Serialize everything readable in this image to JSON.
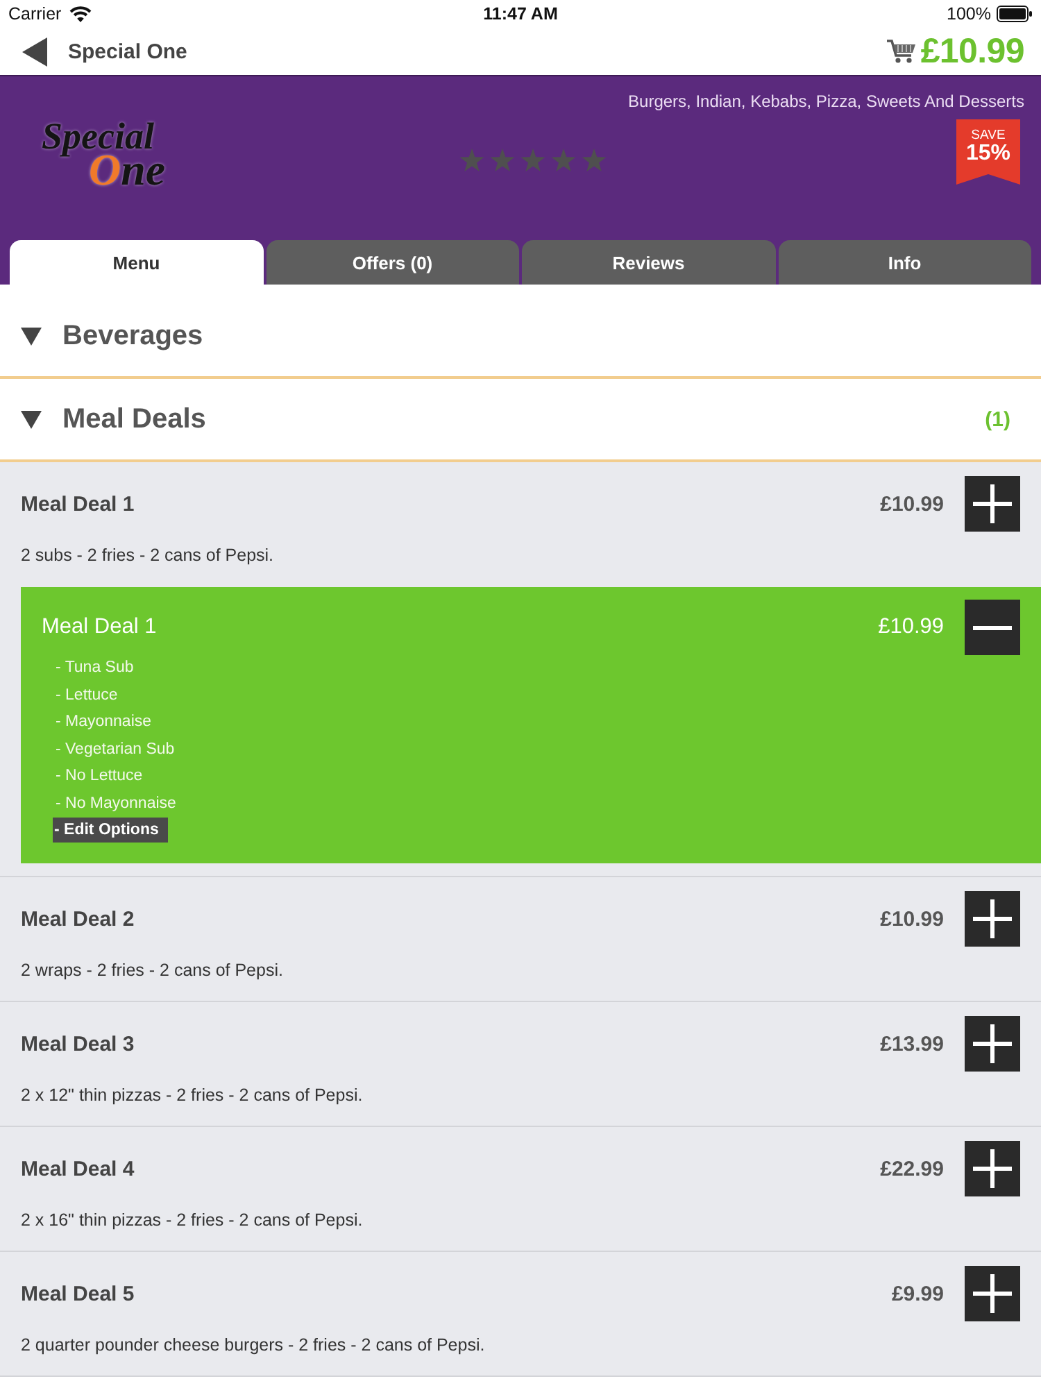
{
  "status_bar": {
    "carrier": "Carrier",
    "time": "11:47 AM",
    "battery": "100%"
  },
  "nav_bar": {
    "title": "Special One",
    "cart_total": "£10.99"
  },
  "header": {
    "logo": {
      "lines": [
        "Special",
        "One"
      ]
    },
    "cuisines": "Burgers, Indian, Kebabs, Pizza, Sweets And Desserts",
    "rating": {
      "stars": 0
    },
    "badge": {
      "label": "SAVE",
      "value": "15%"
    }
  },
  "tabs": [
    {
      "label": "Menu",
      "selected": true
    },
    {
      "label": "Offers (0)",
      "selected": false
    },
    {
      "label": "Reviews",
      "selected": false
    },
    {
      "label": "Info",
      "selected": false
    }
  ],
  "categories": [
    {
      "name": "Beverages"
    },
    {
      "name": "Meal Deals",
      "count": "(1)",
      "items": [
        {
          "name": "Meal Deal 1",
          "price": "£10.99",
          "description": "2 subs - 2 fries - 2 cans of Pepsi.",
          "basket": [
            {
              "name": "Meal Deal 1",
              "price": "£10.99",
              "options": [
                "- Tuna Sub",
                "- Lettuce",
                "- Mayonnaise",
                "- Vegetarian Sub",
                "- No Lettuce",
                "- No Mayonnaise"
              ],
              "edit_label": "- Edit Options"
            }
          ]
        },
        {
          "name": "Meal Deal 2",
          "price": "£10.99",
          "description": "2 wraps - 2 fries - 2 cans of Pepsi."
        },
        {
          "name": "Meal Deal 3",
          "price": "£13.99",
          "description": "2 x 12\" thin pizzas - 2 fries - 2 cans of Pepsi."
        },
        {
          "name": "Meal Deal 4",
          "price": "£22.99",
          "description": "2 x 16\" thin pizzas - 2 fries - 2 cans of Pepsi."
        },
        {
          "name": "Meal Deal 5",
          "price": "£9.99",
          "description": "2 quarter pounder cheese burgers - 2 fries - 2 cans of Pepsi."
        }
      ]
    }
  ]
}
